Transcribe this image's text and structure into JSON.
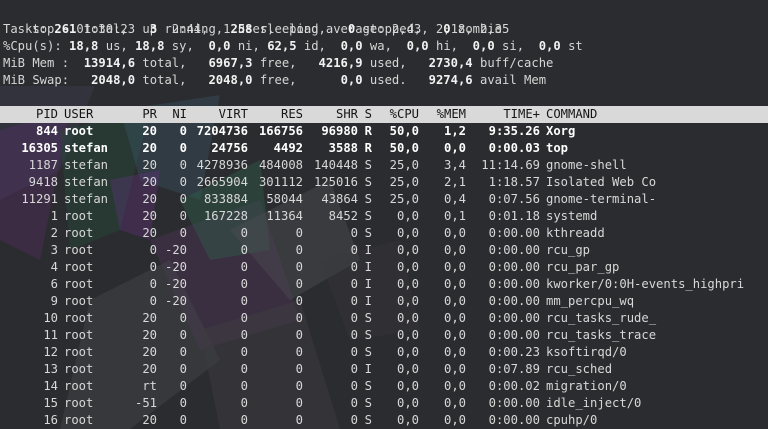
{
  "summary": {
    "line1": "top - 01:30:23 up  2:44,  1 user,  load average: 2,43, 2,18, 2,35",
    "tasks": {
      "label": "Tasks:",
      "total": "261",
      "total_lbl": " total,   ",
      "running": "3",
      "running_lbl": " running, ",
      "sleeping": "258",
      "sleeping_lbl": " sleeping,   ",
      "stopped": "0",
      "stopped_lbl": " stopped,   ",
      "zombie": "0",
      "zombie_lbl": " zombie"
    },
    "cpu": {
      "label": "%Cpu(s): ",
      "us": "18,8",
      "us_lbl": " us, ",
      "sy": "18,8",
      "sy_lbl": " sy,  ",
      "ni": "0,0",
      "ni_lbl": " ni, ",
      "id": "62,5",
      "id_lbl": " id,  ",
      "wa": "0,0",
      "wa_lbl": " wa,  ",
      "hi": "0,0",
      "hi_lbl": " hi,  ",
      "si": "0,0",
      "si_lbl": " si,  ",
      "st": "0,0",
      "st_lbl": " st"
    },
    "mem": {
      "label": "MiB Mem :  ",
      "total": "13914,6",
      "total_lbl": " total,   ",
      "free": "6967,3",
      "free_lbl": " free,   ",
      "used": "4216,9",
      "used_lbl": " used,   ",
      "cache": "2730,4",
      "cache_lbl": " buff/cache"
    },
    "swap": {
      "label": "MiB Swap:   ",
      "total": "2048,0",
      "total_lbl": " total,   ",
      "free": "2048,0",
      "free_lbl": " free,      ",
      "used": "0,0",
      "used_lbl": " used.   ",
      "avail": "9274,6",
      "avail_lbl": " avail Mem"
    }
  },
  "columns": {
    "pid": "PID",
    "user": "USER",
    "pr": "PR",
    "ni": "NI",
    "virt": "VIRT",
    "res": "RES",
    "shr": "SHR",
    "s": "S",
    "cpu": "%CPU",
    "mem": "%MEM",
    "time": "TIME+",
    "cmd": "COMMAND"
  },
  "processes": [
    {
      "pid": "844",
      "user": "root",
      "pr": "20",
      "ni": "0",
      "virt": "7204736",
      "res": "166756",
      "shr": "96980",
      "s": "R",
      "cpu": "50,0",
      "mem": "1,2",
      "time": "9:35.26",
      "cmd": "Xorg",
      "running": true
    },
    {
      "pid": "16305",
      "user": "stefan",
      "pr": "20",
      "ni": "0",
      "virt": "24756",
      "res": "4492",
      "shr": "3588",
      "s": "R",
      "cpu": "50,0",
      "mem": "0,0",
      "time": "0:00.03",
      "cmd": "top",
      "running": true
    },
    {
      "pid": "1187",
      "user": "stefan",
      "pr": "20",
      "ni": "0",
      "virt": "4278936",
      "res": "484008",
      "shr": "140448",
      "s": "S",
      "cpu": "25,0",
      "mem": "3,4",
      "time": "11:14.69",
      "cmd": "gnome-shell",
      "running": false
    },
    {
      "pid": "9418",
      "user": "stefan",
      "pr": "20",
      "ni": "0",
      "virt": "2665904",
      "res": "301112",
      "shr": "125016",
      "s": "S",
      "cpu": "25,0",
      "mem": "2,1",
      "time": "1:18.57",
      "cmd": "Isolated Web Co",
      "running": false
    },
    {
      "pid": "11291",
      "user": "stefan",
      "pr": "20",
      "ni": "0",
      "virt": "833884",
      "res": "58044",
      "shr": "43864",
      "s": "S",
      "cpu": "25,0",
      "mem": "0,4",
      "time": "0:07.56",
      "cmd": "gnome-terminal-",
      "running": false
    },
    {
      "pid": "1",
      "user": "root",
      "pr": "20",
      "ni": "0",
      "virt": "167228",
      "res": "11364",
      "shr": "8452",
      "s": "S",
      "cpu": "0,0",
      "mem": "0,1",
      "time": "0:01.18",
      "cmd": "systemd",
      "running": false
    },
    {
      "pid": "2",
      "user": "root",
      "pr": "20",
      "ni": "0",
      "virt": "0",
      "res": "0",
      "shr": "0",
      "s": "S",
      "cpu": "0,0",
      "mem": "0,0",
      "time": "0:00.00",
      "cmd": "kthreadd",
      "running": false
    },
    {
      "pid": "3",
      "user": "root",
      "pr": "0",
      "ni": "-20",
      "virt": "0",
      "res": "0",
      "shr": "0",
      "s": "I",
      "cpu": "0,0",
      "mem": "0,0",
      "time": "0:00.00",
      "cmd": "rcu_gp",
      "running": false
    },
    {
      "pid": "4",
      "user": "root",
      "pr": "0",
      "ni": "-20",
      "virt": "0",
      "res": "0",
      "shr": "0",
      "s": "I",
      "cpu": "0,0",
      "mem": "0,0",
      "time": "0:00.00",
      "cmd": "rcu_par_gp",
      "running": false
    },
    {
      "pid": "6",
      "user": "root",
      "pr": "0",
      "ni": "-20",
      "virt": "0",
      "res": "0",
      "shr": "0",
      "s": "I",
      "cpu": "0,0",
      "mem": "0,0",
      "time": "0:00.00",
      "cmd": "kworker/0:0H-events_highpri",
      "running": false
    },
    {
      "pid": "9",
      "user": "root",
      "pr": "0",
      "ni": "-20",
      "virt": "0",
      "res": "0",
      "shr": "0",
      "s": "I",
      "cpu": "0,0",
      "mem": "0,0",
      "time": "0:00.00",
      "cmd": "mm_percpu_wq",
      "running": false
    },
    {
      "pid": "10",
      "user": "root",
      "pr": "20",
      "ni": "0",
      "virt": "0",
      "res": "0",
      "shr": "0",
      "s": "S",
      "cpu": "0,0",
      "mem": "0,0",
      "time": "0:00.00",
      "cmd": "rcu_tasks_rude_",
      "running": false
    },
    {
      "pid": "11",
      "user": "root",
      "pr": "20",
      "ni": "0",
      "virt": "0",
      "res": "0",
      "shr": "0",
      "s": "S",
      "cpu": "0,0",
      "mem": "0,0",
      "time": "0:00.00",
      "cmd": "rcu_tasks_trace",
      "running": false
    },
    {
      "pid": "12",
      "user": "root",
      "pr": "20",
      "ni": "0",
      "virt": "0",
      "res": "0",
      "shr": "0",
      "s": "S",
      "cpu": "0,0",
      "mem": "0,0",
      "time": "0:00.23",
      "cmd": "ksoftirqd/0",
      "running": false
    },
    {
      "pid": "13",
      "user": "root",
      "pr": "20",
      "ni": "0",
      "virt": "0",
      "res": "0",
      "shr": "0",
      "s": "I",
      "cpu": "0,0",
      "mem": "0,0",
      "time": "0:07.89",
      "cmd": "rcu_sched",
      "running": false
    },
    {
      "pid": "14",
      "user": "root",
      "pr": "rt",
      "ni": "0",
      "virt": "0",
      "res": "0",
      "shr": "0",
      "s": "S",
      "cpu": "0,0",
      "mem": "0,0",
      "time": "0:00.02",
      "cmd": "migration/0",
      "running": false
    },
    {
      "pid": "15",
      "user": "root",
      "pr": "-51",
      "ni": "0",
      "virt": "0",
      "res": "0",
      "shr": "0",
      "s": "S",
      "cpu": "0,0",
      "mem": "0,0",
      "time": "0:00.00",
      "cmd": "idle_inject/0",
      "running": false
    },
    {
      "pid": "16",
      "user": "root",
      "pr": "20",
      "ni": "0",
      "virt": "0",
      "res": "0",
      "shr": "0",
      "s": "S",
      "cpu": "0,0",
      "mem": "0,0",
      "time": "0:00.00",
      "cmd": "cpuhp/0",
      "running": false
    }
  ],
  "colors": {
    "background": "#2b2c2f",
    "text": "#d6d6d6",
    "header_bar": "#d9d9d9",
    "header_text": "#151515"
  }
}
